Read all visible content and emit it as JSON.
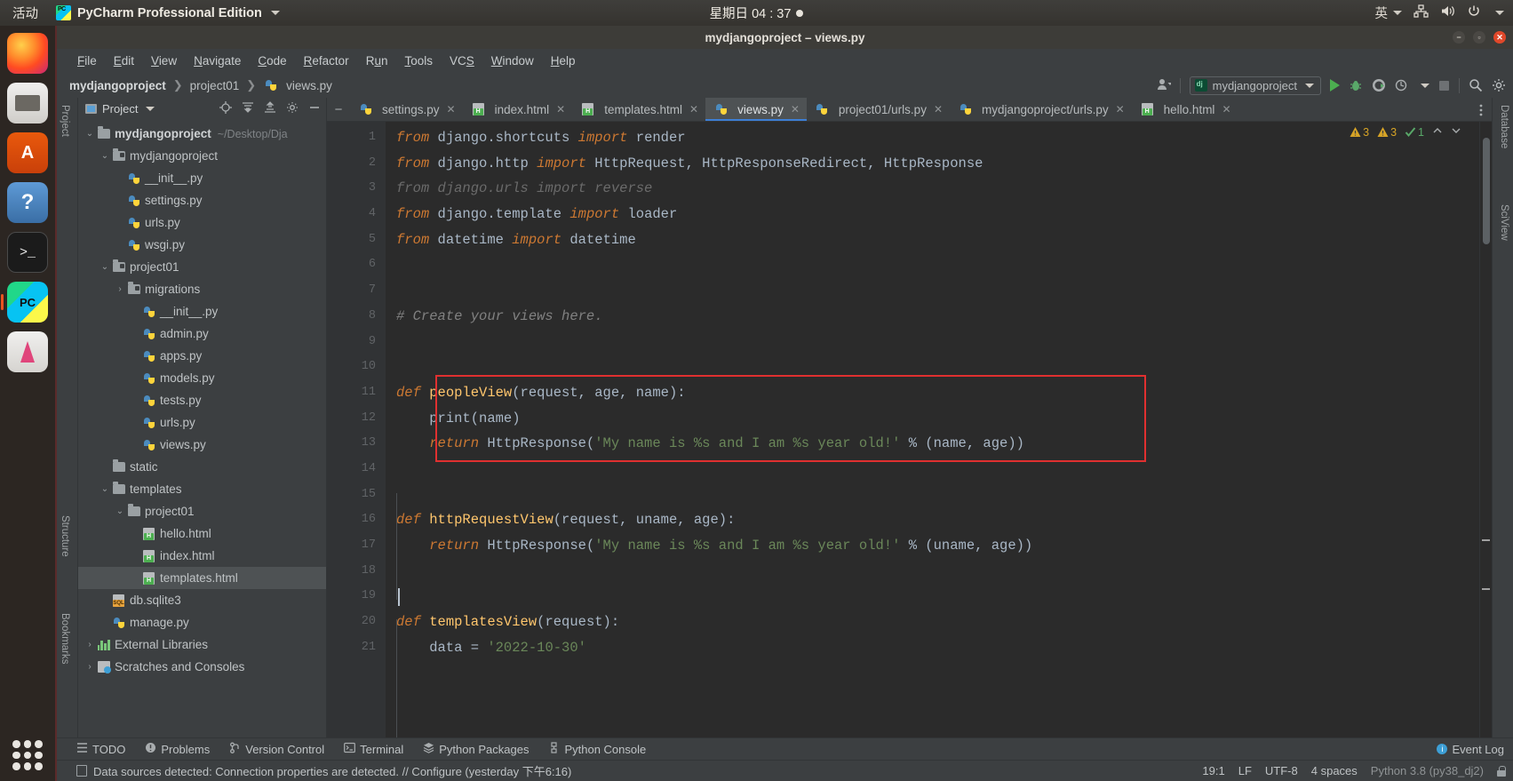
{
  "os_bar": {
    "activities": "活动",
    "app_name": "PyCharm Professional Edition",
    "app_icon": "pycharm-logo-icon",
    "clock": "星期日 04 : 37",
    "input_method": "英",
    "icons": [
      "network-icon",
      "volume-icon",
      "power-icon",
      "chevron-down-icon"
    ]
  },
  "dock": {
    "items": [
      {
        "name": "firefox",
        "label": "Firefox"
      },
      {
        "name": "files",
        "label": "Files"
      },
      {
        "name": "ubuntu-software",
        "label": "Ubuntu Software"
      },
      {
        "name": "help",
        "label": "Help"
      },
      {
        "name": "terminal",
        "label": "Terminal"
      },
      {
        "name": "pycharm",
        "label": "PyCharm"
      },
      {
        "name": "text-editor",
        "label": "Text Editor"
      }
    ],
    "show_apps": "show-applications-grid"
  },
  "window": {
    "title": "mydjangoproject – views.py",
    "buttons": [
      "minimize",
      "maximize",
      "close"
    ]
  },
  "menubar": {
    "items": [
      "File",
      "Edit",
      "View",
      "Navigate",
      "Code",
      "Refactor",
      "Run",
      "Tools",
      "VCS",
      "Window",
      "Help"
    ]
  },
  "navbar": {
    "breadcrumbs": [
      "mydjangoproject",
      "project01",
      "views.py"
    ],
    "run_config": "mydjangoproject",
    "run_config_icon": "django-icon",
    "toolbar_icons": [
      "run-icon",
      "debug-icon",
      "run-coverage-icon",
      "profile-icon",
      "stop-icon",
      "search-everywhere-icon",
      "settings-icon"
    ]
  },
  "project_panel": {
    "title": "Project",
    "header_icons": [
      "locate-icon",
      "expand-all-icon",
      "collapse-all-icon",
      "settings-icon",
      "hide-icon"
    ],
    "tree": [
      {
        "label": "mydjangoproject",
        "sub": "~/Desktop/Dja",
        "icon": "folder",
        "indent": 0,
        "arrow": "open",
        "bold": true
      },
      {
        "label": "mydjangoproject",
        "sub": "",
        "icon": "folder-module",
        "indent": 1,
        "arrow": "open",
        "bold": false
      },
      {
        "label": "__init__.py",
        "sub": "",
        "icon": "python",
        "indent": 2,
        "arrow": "none",
        "bold": false
      },
      {
        "label": "settings.py",
        "sub": "",
        "icon": "python",
        "indent": 2,
        "arrow": "none",
        "bold": false
      },
      {
        "label": "urls.py",
        "sub": "",
        "icon": "python",
        "indent": 2,
        "arrow": "none",
        "bold": false
      },
      {
        "label": "wsgi.py",
        "sub": "",
        "icon": "python",
        "indent": 2,
        "arrow": "none",
        "bold": false
      },
      {
        "label": "project01",
        "sub": "",
        "icon": "folder-module",
        "indent": 1,
        "arrow": "open",
        "bold": false
      },
      {
        "label": "migrations",
        "sub": "",
        "icon": "folder-module",
        "indent": 2,
        "arrow": "closed",
        "bold": false
      },
      {
        "label": "__init__.py",
        "sub": "",
        "icon": "python",
        "indent": 3,
        "arrow": "none",
        "bold": false
      },
      {
        "label": "admin.py",
        "sub": "",
        "icon": "python",
        "indent": 3,
        "arrow": "none",
        "bold": false
      },
      {
        "label": "apps.py",
        "sub": "",
        "icon": "python",
        "indent": 3,
        "arrow": "none",
        "bold": false
      },
      {
        "label": "models.py",
        "sub": "",
        "icon": "python",
        "indent": 3,
        "arrow": "none",
        "bold": false
      },
      {
        "label": "tests.py",
        "sub": "",
        "icon": "python",
        "indent": 3,
        "arrow": "none",
        "bold": false
      },
      {
        "label": "urls.py",
        "sub": "",
        "icon": "python",
        "indent": 3,
        "arrow": "none",
        "bold": false
      },
      {
        "label": "views.py",
        "sub": "",
        "icon": "python",
        "indent": 3,
        "arrow": "none",
        "bold": false
      },
      {
        "label": "static",
        "sub": "",
        "icon": "folder",
        "indent": 1,
        "arrow": "none",
        "bold": false
      },
      {
        "label": "templates",
        "sub": "",
        "icon": "folder",
        "indent": 1,
        "arrow": "open",
        "bold": false
      },
      {
        "label": "project01",
        "sub": "",
        "icon": "folder",
        "indent": 2,
        "arrow": "open",
        "bold": false
      },
      {
        "label": "hello.html",
        "sub": "",
        "icon": "html",
        "indent": 3,
        "arrow": "none",
        "bold": false
      },
      {
        "label": "index.html",
        "sub": "",
        "icon": "html",
        "indent": 3,
        "arrow": "none",
        "bold": false
      },
      {
        "label": "templates.html",
        "sub": "",
        "icon": "html",
        "indent": 3,
        "arrow": "none",
        "bold": false,
        "selected": true
      },
      {
        "label": "db.sqlite3",
        "sub": "",
        "icon": "sqlite",
        "indent": 1,
        "arrow": "none",
        "bold": false
      },
      {
        "label": "manage.py",
        "sub": "",
        "icon": "python",
        "indent": 1,
        "arrow": "none",
        "bold": false
      },
      {
        "label": "External Libraries",
        "sub": "",
        "icon": "library",
        "indent": 0,
        "arrow": "closed",
        "bold": false
      },
      {
        "label": "Scratches and Consoles",
        "sub": "",
        "icon": "scratch",
        "indent": 0,
        "arrow": "closed",
        "bold": false
      }
    ]
  },
  "side_strips": {
    "left_top": "Project",
    "left_mid": "Structure",
    "left_bottom": "Bookmarks",
    "right_top": "Database",
    "right_mid": "SciView"
  },
  "tabs": [
    {
      "label": "settings.py",
      "icon": "python",
      "active": false
    },
    {
      "label": "index.html",
      "icon": "html",
      "active": false
    },
    {
      "label": "templates.html",
      "icon": "html",
      "active": false
    },
    {
      "label": "views.py",
      "icon": "python",
      "active": true
    },
    {
      "label": "project01/urls.py",
      "icon": "python",
      "active": false
    },
    {
      "label": "mydjangoproject/urls.py",
      "icon": "python",
      "active": false
    },
    {
      "label": "hello.html",
      "icon": "html",
      "active": false
    }
  ],
  "editor": {
    "status": {
      "warnings": "3",
      "errors": "3",
      "checks": "1"
    },
    "lines": [
      {
        "n": "1",
        "fold": "start",
        "segs": [
          {
            "t": "from ",
            "c": "kw"
          },
          {
            "t": "django.shortcuts ",
            "c": "plain"
          },
          {
            "t": "import ",
            "c": "kw"
          },
          {
            "t": "render",
            "c": "plain"
          }
        ]
      },
      {
        "n": "2",
        "fold": "",
        "segs": [
          {
            "t": "from ",
            "c": "kw"
          },
          {
            "t": "django.http ",
            "c": "plain"
          },
          {
            "t": "import ",
            "c": "kw"
          },
          {
            "t": "HttpRequest, HttpResponseRedirect, HttpResponse",
            "c": "plain"
          }
        ]
      },
      {
        "n": "3",
        "fold": "",
        "segs": [
          {
            "t": "from django.urls import reverse",
            "c": "dim"
          }
        ]
      },
      {
        "n": "4",
        "fold": "",
        "segs": [
          {
            "t": "from ",
            "c": "kw"
          },
          {
            "t": "django.template ",
            "c": "plain"
          },
          {
            "t": "import ",
            "c": "kw"
          },
          {
            "t": "loader",
            "c": "plain"
          }
        ]
      },
      {
        "n": "5",
        "fold": "start",
        "segs": [
          {
            "t": "from ",
            "c": "kw"
          },
          {
            "t": "datetime ",
            "c": "plain"
          },
          {
            "t": "import ",
            "c": "kw"
          },
          {
            "t": "datetime",
            "c": "plain"
          }
        ]
      },
      {
        "n": "6",
        "fold": "",
        "segs": []
      },
      {
        "n": "7",
        "fold": "",
        "segs": []
      },
      {
        "n": "8",
        "fold": "",
        "segs": [
          {
            "t": "# Create your views here.",
            "c": "com"
          }
        ]
      },
      {
        "n": "9",
        "fold": "",
        "segs": []
      },
      {
        "n": "10",
        "fold": "",
        "segs": []
      },
      {
        "n": "11",
        "fold": "start",
        "segs": [
          {
            "t": "def ",
            "c": "kw"
          },
          {
            "t": "peopleView",
            "c": "fn"
          },
          {
            "t": "(request, age, name):",
            "c": "plain"
          }
        ]
      },
      {
        "n": "12",
        "fold": "",
        "segs": [
          {
            "t": "    print(name)",
            "c": "plain"
          }
        ]
      },
      {
        "n": "13",
        "fold": "end",
        "segs": [
          {
            "t": "    return ",
            "c": "kw"
          },
          {
            "t": "HttpResponse(",
            "c": "plain"
          },
          {
            "t": "'My name is %s and I am %s year old!'",
            "c": "str"
          },
          {
            "t": " % (name, age))",
            "c": "plain"
          }
        ]
      },
      {
        "n": "14",
        "fold": "",
        "segs": []
      },
      {
        "n": "15",
        "fold": "",
        "segs": []
      },
      {
        "n": "16",
        "fold": "start",
        "segs": [
          {
            "t": "def ",
            "c": "kw"
          },
          {
            "t": "httpRequestView",
            "c": "fn"
          },
          {
            "t": "(request, uname, age):",
            "c": "plain"
          }
        ]
      },
      {
        "n": "17",
        "fold": "end",
        "segs": [
          {
            "t": "    return ",
            "c": "kw"
          },
          {
            "t": "HttpResponse(",
            "c": "plain"
          },
          {
            "t": "'My name is %s and I am %s year old!'",
            "c": "str"
          },
          {
            "t": " % (uname, age))",
            "c": "plain"
          }
        ]
      },
      {
        "n": "18",
        "fold": "",
        "segs": []
      },
      {
        "n": "19",
        "fold": "",
        "segs": [],
        "caret": true
      },
      {
        "n": "20",
        "fold": "start",
        "segs": [
          {
            "t": "def ",
            "c": "kw"
          },
          {
            "t": "templatesView",
            "c": "fn"
          },
          {
            "t": "(request):",
            "c": "plain"
          }
        ]
      },
      {
        "n": "21",
        "fold": "",
        "segs": [
          {
            "t": "    data = ",
            "c": "plain"
          },
          {
            "t": "'2022-10-30'",
            "c": "str"
          }
        ]
      }
    ],
    "highlight_box": {
      "from_line": 11,
      "to_line": 13,
      "color": "#e03030"
    }
  },
  "bottom_toolwindows": [
    {
      "label": "TODO",
      "icon": "todo-icon"
    },
    {
      "label": "Problems",
      "icon": "problems-icon"
    },
    {
      "label": "Version Control",
      "icon": "vcs-icon"
    },
    {
      "label": "Terminal",
      "icon": "terminal-icon"
    },
    {
      "label": "Python Packages",
      "icon": "packages-icon"
    },
    {
      "label": "Python Console",
      "icon": "python-console-icon"
    }
  ],
  "event_log": "Event Log",
  "statusbar": {
    "message": "Data sources detected: Connection properties are detected. // Configure (yesterday 下午6:16)",
    "position": "19:1",
    "line_sep": "LF",
    "encoding": "UTF-8",
    "indent": "4 spaces",
    "interpreter": "Python 3.8 (py38_dj2)"
  }
}
